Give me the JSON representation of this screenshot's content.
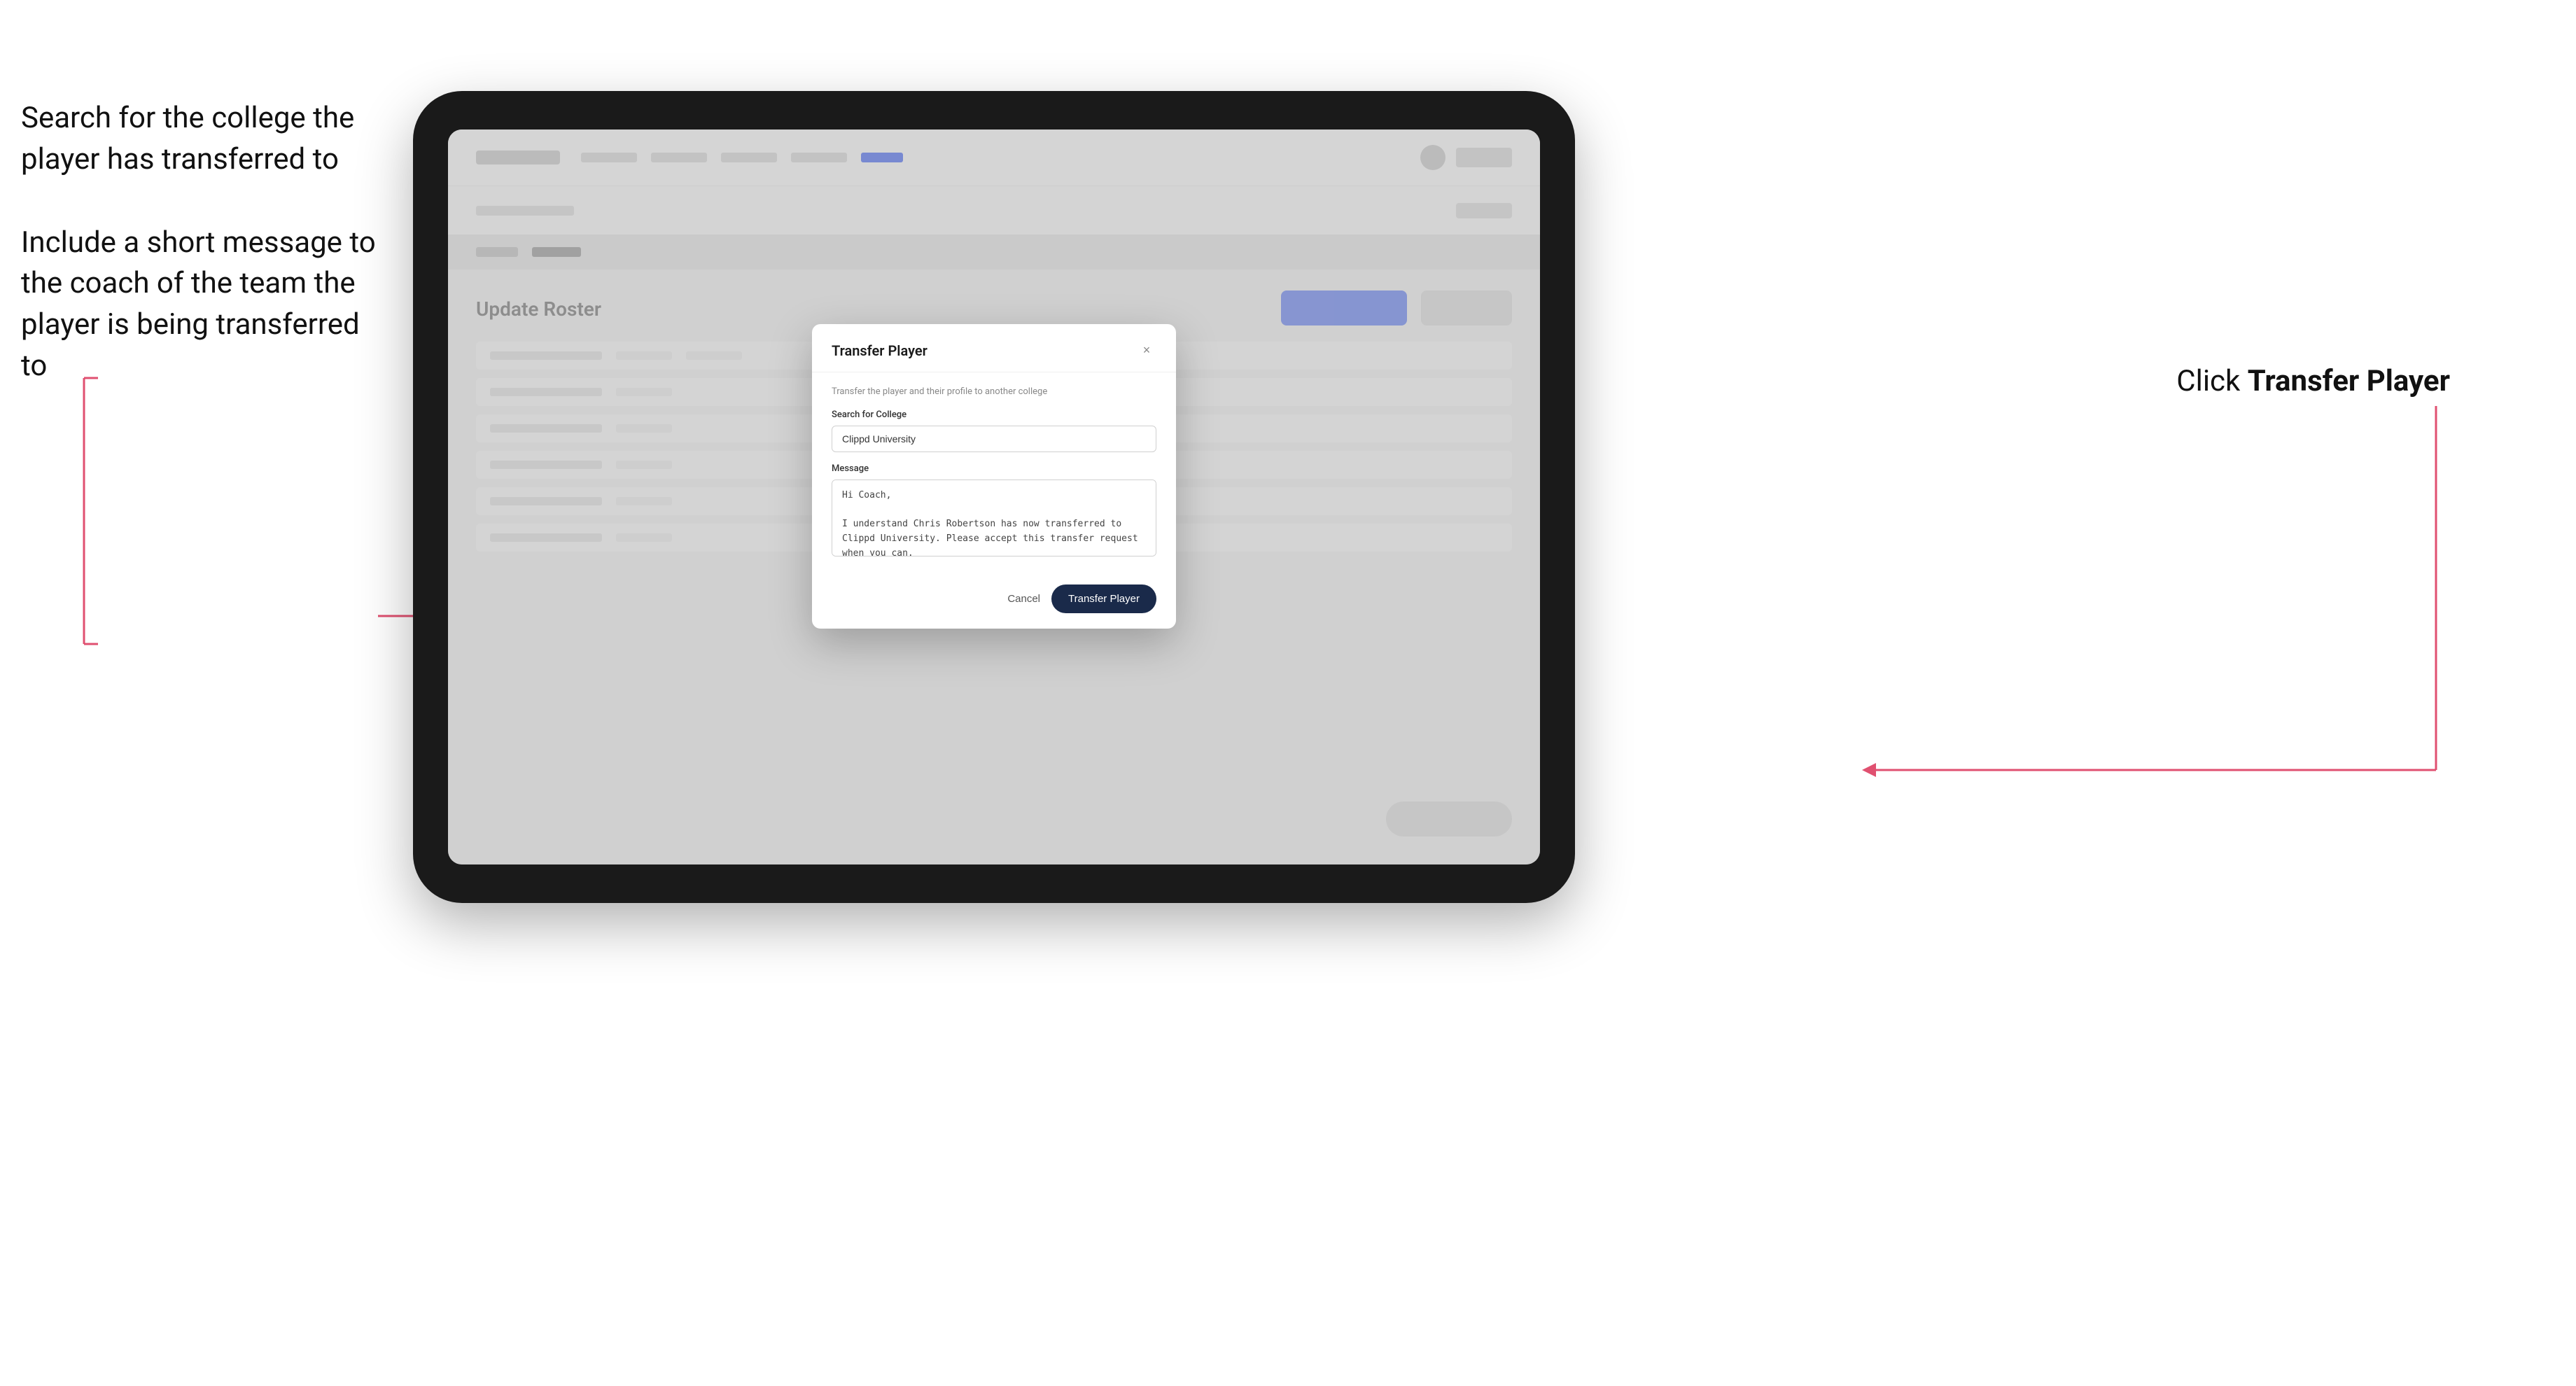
{
  "annotations": {
    "left_top": "Search for the college the player has transferred to",
    "left_bottom": "Include a short message to the coach of the team the player is being transferred to",
    "right": "Click ",
    "right_bold": "Transfer Player"
  },
  "dialog": {
    "title": "Transfer Player",
    "subtitle": "Transfer the player and their profile to another college",
    "search_label": "Search for College",
    "search_value": "Clippd University",
    "message_label": "Message",
    "message_value": "Hi Coach,\n\nI understand Chris Robertson has now transferred to Clippd University. Please accept this transfer request when you can.",
    "cancel_label": "Cancel",
    "transfer_label": "Transfer Player",
    "close_icon": "×"
  },
  "app": {
    "page_title": "Update Roster"
  }
}
